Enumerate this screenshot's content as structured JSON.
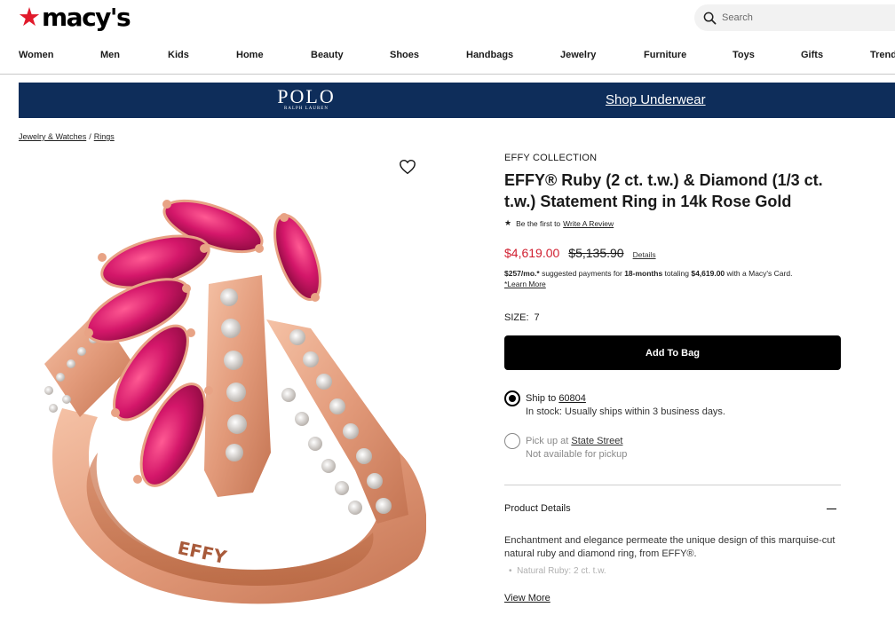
{
  "header": {
    "logo": "macy's",
    "search_placeholder": "Search"
  },
  "nav": [
    {
      "label": "Women"
    },
    {
      "label": "Men"
    },
    {
      "label": "Kids"
    },
    {
      "label": "Home"
    },
    {
      "label": "Beauty"
    },
    {
      "label": "Shoes"
    },
    {
      "label": "Handbags"
    },
    {
      "label": "Jewelry"
    },
    {
      "label": "Furniture"
    },
    {
      "label": "Toys"
    },
    {
      "label": "Gifts"
    },
    {
      "label": "Trends"
    }
  ],
  "banner": {
    "brand_line1": "POLO",
    "brand_line2": "RALPH LAUREN",
    "cta": "Shop Underwear",
    "bg_color": "#0e2d5a"
  },
  "breadcrumb": [
    {
      "label": "Jewelry & Watches"
    },
    {
      "label": "Rings"
    }
  ],
  "breadcrumb_separator": "/",
  "product": {
    "brand": "EFFY COLLECTION",
    "title": "EFFY® Ruby (2 ct. t.w.) & Diamond (1/3 ct. t.w.) Statement Ring in 14k Rose Gold",
    "review_prefix": "Be the first to",
    "review_link": "Write A Review",
    "price_sale": "$4,619.00",
    "price_original": "$5,135.90",
    "details_link": "Details",
    "finance": {
      "monthly": "$257/mo.*",
      "text1": "suggested payments for",
      "months": "18-months",
      "text2": "totaling",
      "total": "$4,619.00",
      "text3": "with a Macy's Card.",
      "learn_more": "*Learn More"
    },
    "size_label": "SIZE:",
    "size_value": "7",
    "add_to_bag": "Add To Bag",
    "ship": {
      "label": "Ship to",
      "zip": "60804",
      "status": "In stock: Usually ships within 3 business days."
    },
    "pickup": {
      "label": "Pick up at",
      "store": "State Street",
      "status": "Not available for pickup"
    },
    "details_heading": "Product Details",
    "description": "Enchantment and elegance permeate the unique design of this marquise-cut natural ruby and diamond ring, from EFFY®.",
    "bullet": "Natural Ruby: 2 ct. t.w.",
    "view_more": "View More",
    "ring_engraving": "EFFY"
  },
  "colors": {
    "accent_red": "#e11a2b",
    "sale_red": "#d12031",
    "rose_gold": "#e8a385",
    "ruby": "#c3155c"
  }
}
